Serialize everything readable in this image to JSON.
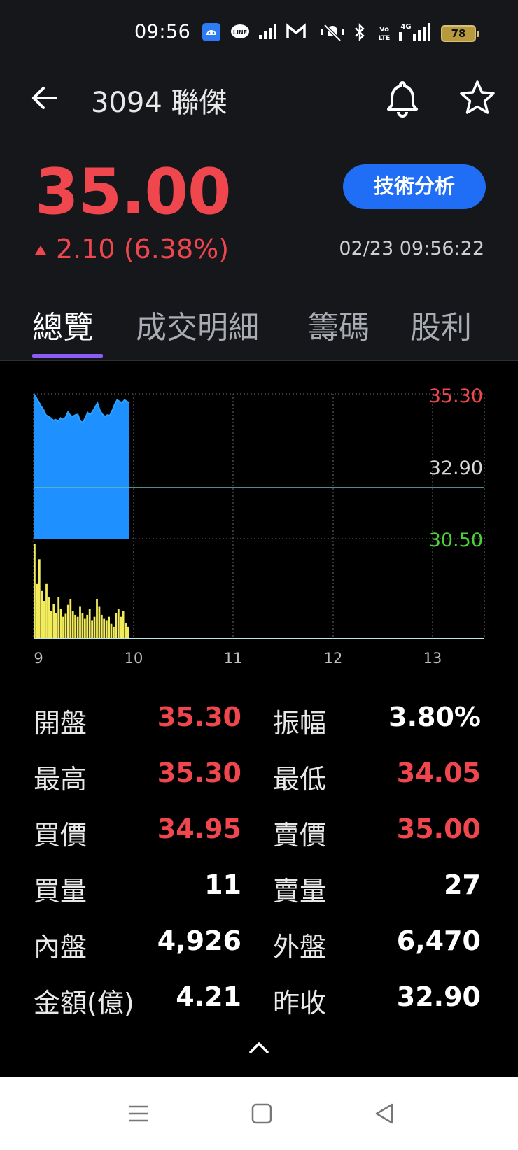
{
  "status_bar": {
    "time": "09:56",
    "network": "4G",
    "volte": "Vo LTE",
    "battery": "78",
    "icons": [
      "android-notification-icon",
      "line-icon",
      "signal-bars-icon",
      "gmail-icon",
      "mute-icon",
      "bluetooth-icon",
      "volte-icon",
      "signal-4g-icon",
      "battery-icon"
    ]
  },
  "header": {
    "title": "3094 聯傑",
    "price": "35.00",
    "change": "2.10 (6.38%)",
    "timestamp": "02/23 09:56:22",
    "ta_button": "技術分析"
  },
  "tabs": [
    {
      "label": "總覽",
      "active": true
    },
    {
      "label": "成交明細"
    },
    {
      "label": "籌碼"
    },
    {
      "label": "股利"
    }
  ],
  "chart_data": {
    "type": "area",
    "y_labels": {
      "high": "35.30",
      "ref": "32.90",
      "low": "30.50"
    },
    "x_labels": [
      "9",
      "10",
      "11",
      "12",
      "13"
    ],
    "ylim": [
      30.5,
      35.3
    ],
    "reference": 32.9,
    "price_series": [
      35.3,
      35.18,
      35.05,
      34.9,
      34.78,
      34.6,
      34.55,
      34.5,
      34.42,
      34.45,
      34.38,
      34.5,
      34.45,
      34.52,
      34.7,
      34.58,
      34.55,
      34.6,
      34.62,
      34.4,
      34.35,
      34.5,
      34.68,
      34.6,
      34.72,
      34.85,
      35.0,
      34.75,
      34.62,
      34.55,
      34.6,
      34.58,
      34.75,
      34.95,
      35.1,
      35.05,
      35.0,
      35.1,
      35.05,
      35.0
    ],
    "volume_series": [
      95,
      55,
      80,
      48,
      38,
      55,
      42,
      28,
      35,
      26,
      42,
      30,
      22,
      25,
      34,
      40,
      28,
      24,
      22,
      32,
      26,
      20,
      24,
      30,
      18,
      22,
      40,
      32,
      24,
      20,
      18,
      22,
      15,
      12,
      26,
      30,
      22,
      28,
      16,
      12
    ]
  },
  "stats": {
    "left": [
      {
        "label": "開盤",
        "value": "35.30",
        "red": true
      },
      {
        "label": "最高",
        "value": "35.30",
        "red": true
      },
      {
        "label": "買價",
        "value": "34.95",
        "red": true
      },
      {
        "label": "買量",
        "value": "11",
        "red": false
      },
      {
        "label": "內盤",
        "value": "4,926",
        "red": false
      },
      {
        "label": "金額(億)",
        "value": "4.21",
        "red": false
      }
    ],
    "right": [
      {
        "label": "振幅",
        "value": "3.80%",
        "red": false
      },
      {
        "label": "最低",
        "value": "34.05",
        "red": true
      },
      {
        "label": "賣價",
        "value": "35.00",
        "red": true
      },
      {
        "label": "賣量",
        "value": "27",
        "red": false
      },
      {
        "label": "外盤",
        "value": "6,470",
        "red": false
      },
      {
        "label": "昨收",
        "value": "32.90",
        "red": false
      }
    ]
  },
  "colors": {
    "up": "#f0474f",
    "down": "#4cd137",
    "accent": "#1f6ef5",
    "tab_indicator": "#8b5cf6",
    "price_area": "#1e90ff",
    "volume": "#f2ec5c"
  }
}
